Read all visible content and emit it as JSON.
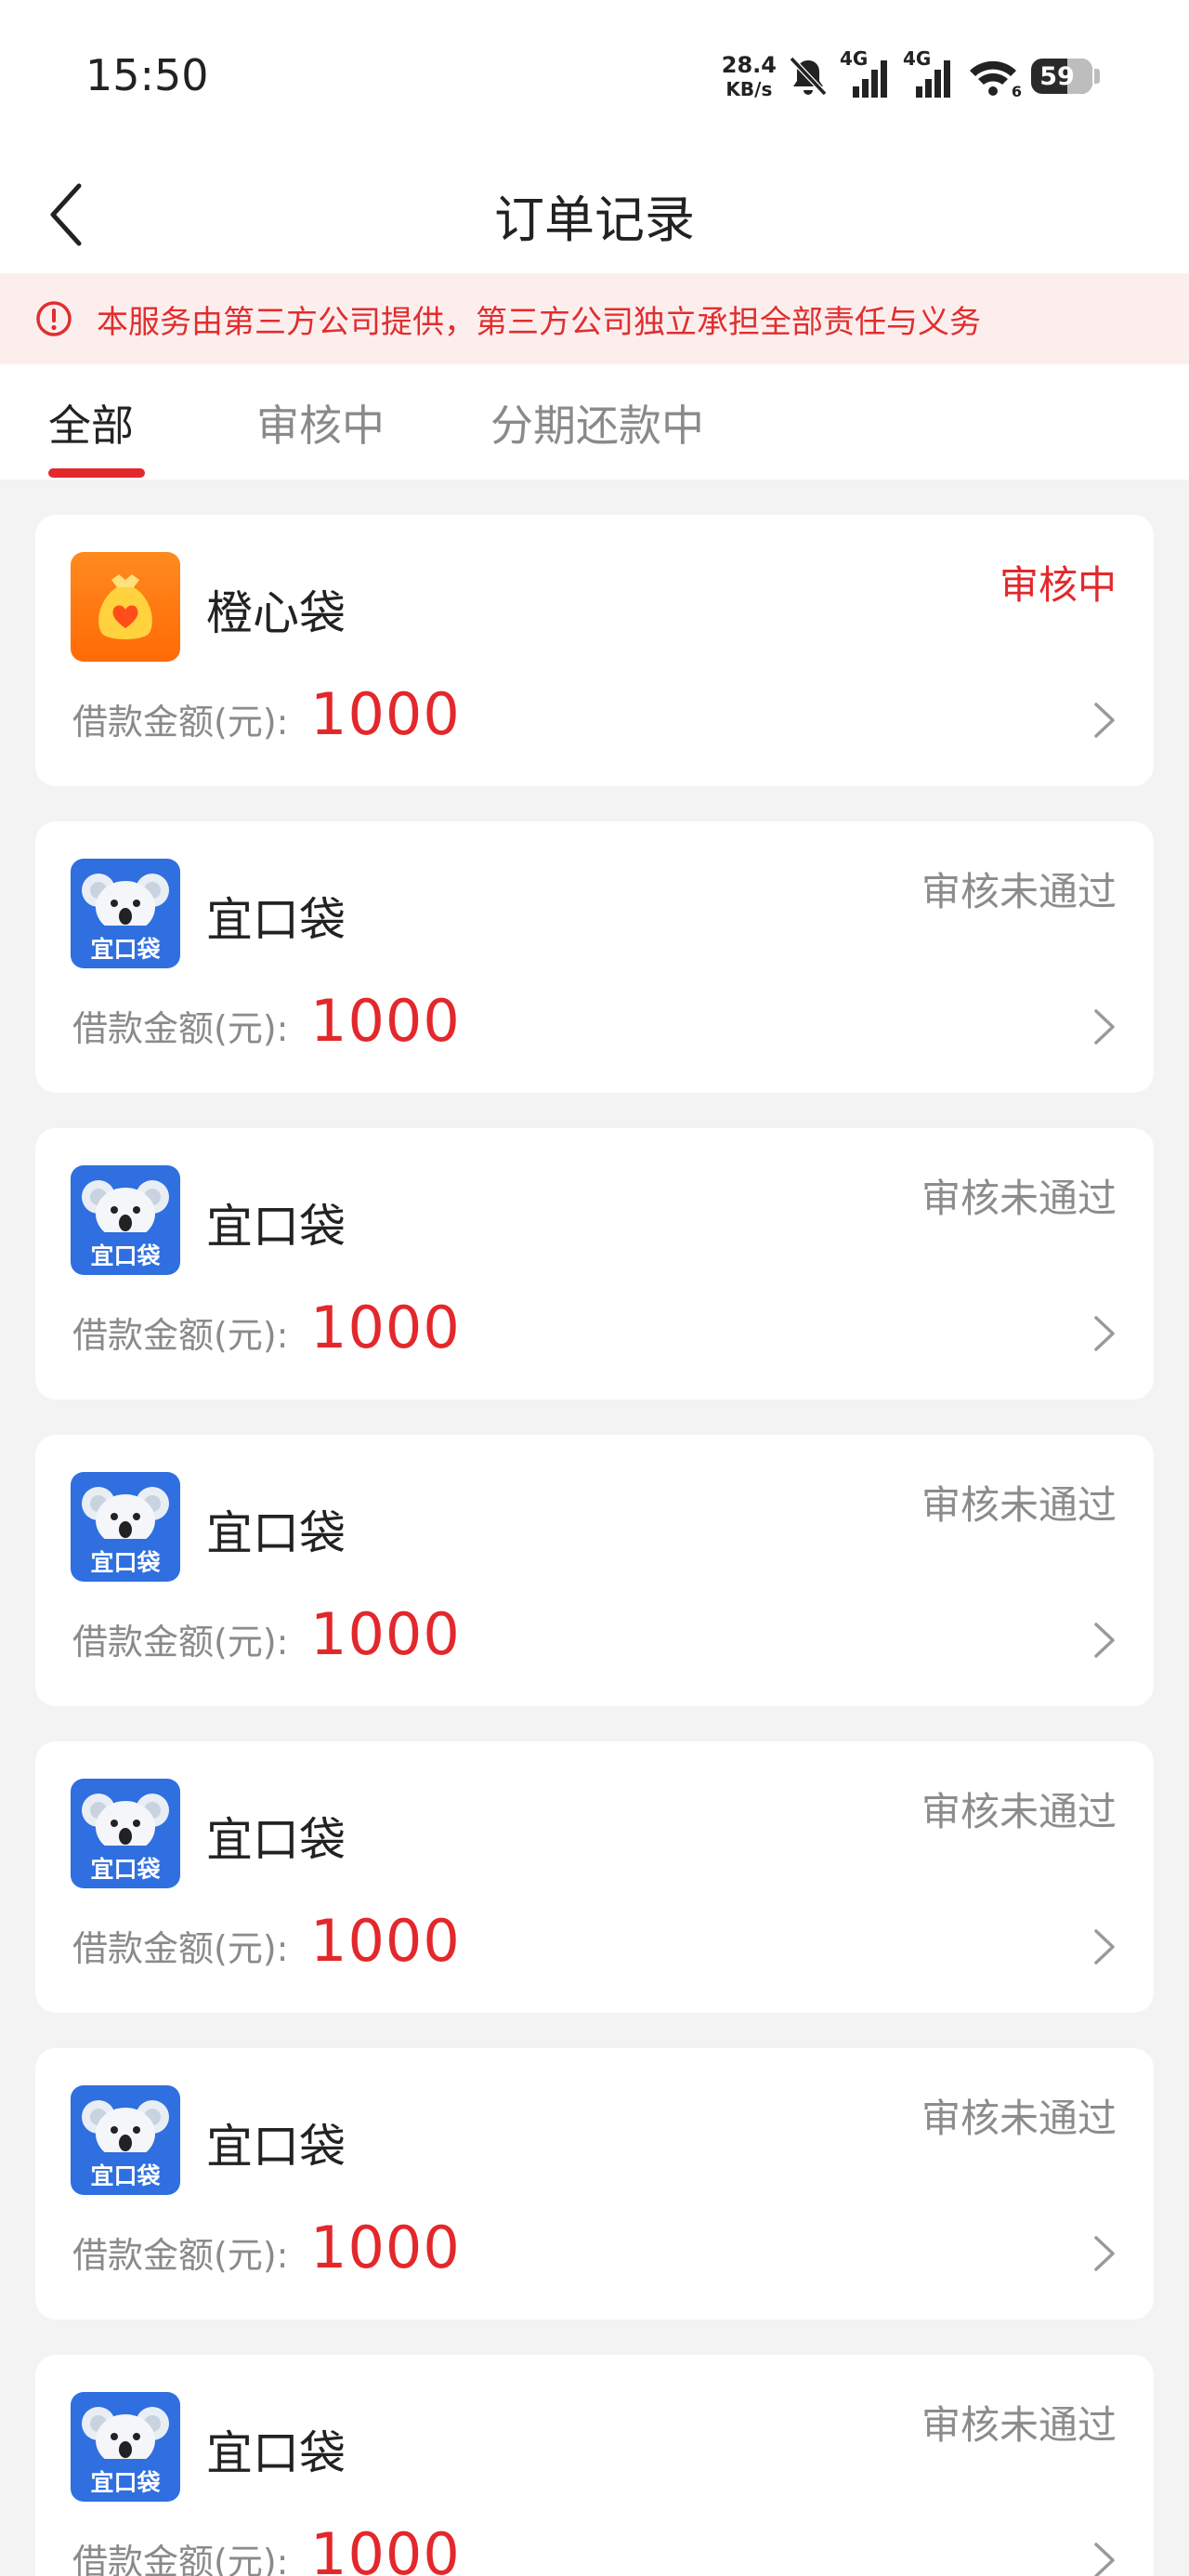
{
  "status_bar": {
    "time": "15:50",
    "net_speed_value": "28.4",
    "net_speed_unit": "KB/s",
    "sim1": "4G",
    "sim2": "4G",
    "wifi_sub": "6",
    "battery": "59",
    "battery_percent": 59,
    "icons": [
      "bell-muted-icon",
      "signal-icon",
      "signal-icon",
      "wifi-icon",
      "battery-icon"
    ]
  },
  "nav": {
    "title": "订单记录",
    "back_icon": "chevron-left-icon"
  },
  "notice": {
    "icon": "alert-circle-icon",
    "text": "本服务由第三方公司提供，第三方公司独立承担全部责任与义务"
  },
  "tabs": [
    {
      "label": "全部",
      "active": true
    },
    {
      "label": "审核中",
      "active": false
    },
    {
      "label": "分期还款中",
      "active": false
    }
  ],
  "orders": [
    {
      "name": "橙心袋",
      "status": "审核中",
      "status_type": "pending",
      "amount_label": "借款金额(元):",
      "amount": "1000",
      "logo": "orange-bag-logo"
    },
    {
      "name": "宜口袋",
      "status": "审核未通过",
      "status_type": "rejected",
      "amount_label": "借款金额(元):",
      "amount": "1000",
      "logo": "koala-logo"
    },
    {
      "name": "宜口袋",
      "status": "审核未通过",
      "status_type": "rejected",
      "amount_label": "借款金额(元):",
      "amount": "1000",
      "logo": "koala-logo"
    },
    {
      "name": "宜口袋",
      "status": "审核未通过",
      "status_type": "rejected",
      "amount_label": "借款金额(元):",
      "amount": "1000",
      "logo": "koala-logo"
    },
    {
      "name": "宜口袋",
      "status": "审核未通过",
      "status_type": "rejected",
      "amount_label": "借款金额(元):",
      "amount": "1000",
      "logo": "koala-logo"
    },
    {
      "name": "宜口袋",
      "status": "审核未通过",
      "status_type": "rejected",
      "amount_label": "借款金额(元):",
      "amount": "1000",
      "logo": "koala-logo"
    },
    {
      "name": "宜口袋",
      "status": "审核未通过",
      "status_type": "rejected",
      "amount_label": "借款金额(元):",
      "amount": "1000",
      "logo": "koala-logo"
    }
  ],
  "logo_text": {
    "koala_caption": "宜口袋"
  },
  "colors": {
    "accent_red": "#e3282c",
    "notice_bg": "#fdeeee",
    "page_bg": "#f3f3f3",
    "koala_blue": "#2f6fe0",
    "orange": "#ff7a12"
  }
}
